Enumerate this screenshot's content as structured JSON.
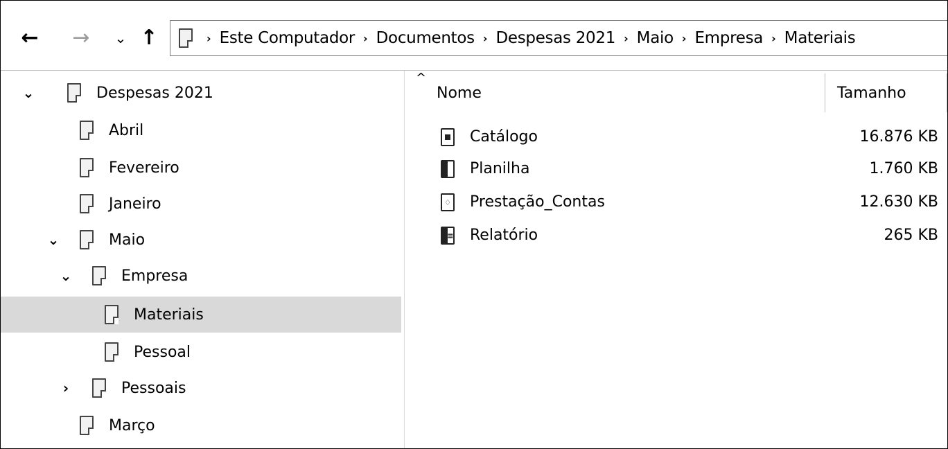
{
  "navigation": {
    "back_glyph": "←",
    "forward_glyph": "→",
    "recent_glyph": "⌄",
    "up_glyph": "↑"
  },
  "breadcrumb": {
    "separator": "›",
    "items": [
      "Este Computador",
      "Documentos",
      "Despesas 2021",
      "Maio",
      "Empresa",
      "Materiais"
    ]
  },
  "tree": {
    "items": [
      {
        "label": "Despesas 2021",
        "chevron": "expanded",
        "selected": false
      },
      {
        "label": "Abril",
        "chevron": "none",
        "selected": false
      },
      {
        "label": "Fevereiro",
        "chevron": "none",
        "selected": false
      },
      {
        "label": "Janeiro",
        "chevron": "none",
        "selected": false
      },
      {
        "label": "Maio",
        "chevron": "expanded",
        "selected": false
      },
      {
        "label": "Empresa",
        "chevron": "expanded",
        "selected": false
      },
      {
        "label": "Materiais",
        "chevron": "none",
        "selected": true
      },
      {
        "label": "Pessoal",
        "chevron": "none",
        "selected": false
      },
      {
        "label": "Pessoais",
        "chevron": "collapsed",
        "selected": false
      },
      {
        "label": "Março",
        "chevron": "none",
        "selected": false
      }
    ]
  },
  "files": {
    "columns": {
      "name": "Nome",
      "size": "Tamanho",
      "sort_glyph": "^"
    },
    "rows": [
      {
        "name": "Catálogo",
        "size": "16.876 KB",
        "icon": "document-icon"
      },
      {
        "name": "Planilha",
        "size": "1.760 KB",
        "icon": "word-document-icon"
      },
      {
        "name": "Prestação_Contas",
        "size": "12.630 KB",
        "icon": "pdf-document-icon"
      },
      {
        "name": "Relatório",
        "size": "265 KB",
        "icon": "excel-document-icon"
      }
    ]
  },
  "colors": {
    "selection": "#d9d9d9",
    "border": "#7a7a7a",
    "disabled": "#9a9a9a"
  }
}
